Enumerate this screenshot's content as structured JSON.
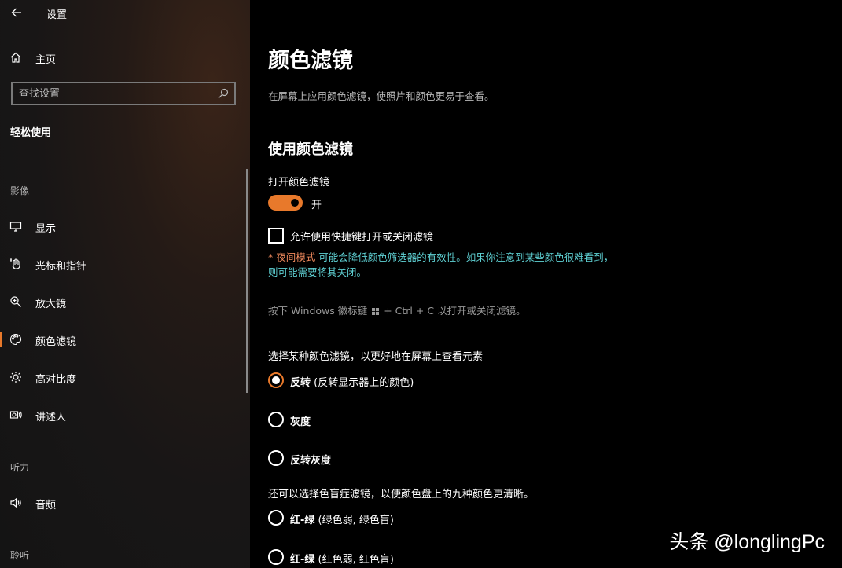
{
  "window": {
    "title": "设置"
  },
  "sidebar": {
    "home_label": "主页",
    "search_placeholder": "查找设置",
    "section_title": "轻松使用",
    "groups": {
      "vision": "影像",
      "hearing": "听力",
      "hearing2": "聆听"
    },
    "items": [
      {
        "label": "显示",
        "icon": "monitor-icon"
      },
      {
        "label": "光标和指针",
        "icon": "pointer-icon"
      },
      {
        "label": "放大镜",
        "icon": "magnifier-icon"
      },
      {
        "label": "颜色滤镜",
        "icon": "palette-icon",
        "selected": true
      },
      {
        "label": "高对比度",
        "icon": "brightness-icon"
      },
      {
        "label": "讲述人",
        "icon": "narrator-icon"
      },
      {
        "label": "音频",
        "icon": "speaker-icon"
      }
    ]
  },
  "main": {
    "title": "颜色滤镜",
    "description": "在屏幕上应用颜色滤镜，使照片和颜色更易于查看。",
    "subtitle": "使用颜色滤镜",
    "toggle_label": "打开颜色滤镜",
    "toggle_state": "开",
    "toggle_on": true,
    "shortcut_checkbox_label": "允许使用快捷键打开或关闭滤镜",
    "shortcut_checked": false,
    "note_prefix": "* 夜间模式",
    "note_text": " 可能会降低颜色筛选器的有效性。如果你注意到某些颜色很难看到，则可能需要将其关闭。",
    "hint_before": "按下 Windows 徽标键",
    "hint_after": "+ Ctrl + C 以打开或关闭滤镜。",
    "choose_label": "选择某种颜色滤镜，以更好地在屏幕上查看元素",
    "filters": [
      {
        "name": "反转",
        "desc": " (反转显示器上的颜色)",
        "checked": true
      },
      {
        "name": "灰度",
        "desc": "",
        "checked": false
      },
      {
        "name": "反转灰度",
        "desc": "",
        "checked": false
      }
    ],
    "colorblind_label": "还可以选择色盲症滤镜，以使颜色盘上的九种颜色更清晰。",
    "colorblind_filters": [
      {
        "name": "红-绿",
        "desc": " (绿色弱, 绿色盲)",
        "checked": false
      },
      {
        "name": "红-绿",
        "desc": " (红色弱, 红色盲)",
        "checked": false
      }
    ]
  },
  "watermark": "头条 @longlingPc",
  "colors": {
    "accent": "#e8792b",
    "note": "#5fd1d4",
    "night_mode": "#f08a5d"
  }
}
